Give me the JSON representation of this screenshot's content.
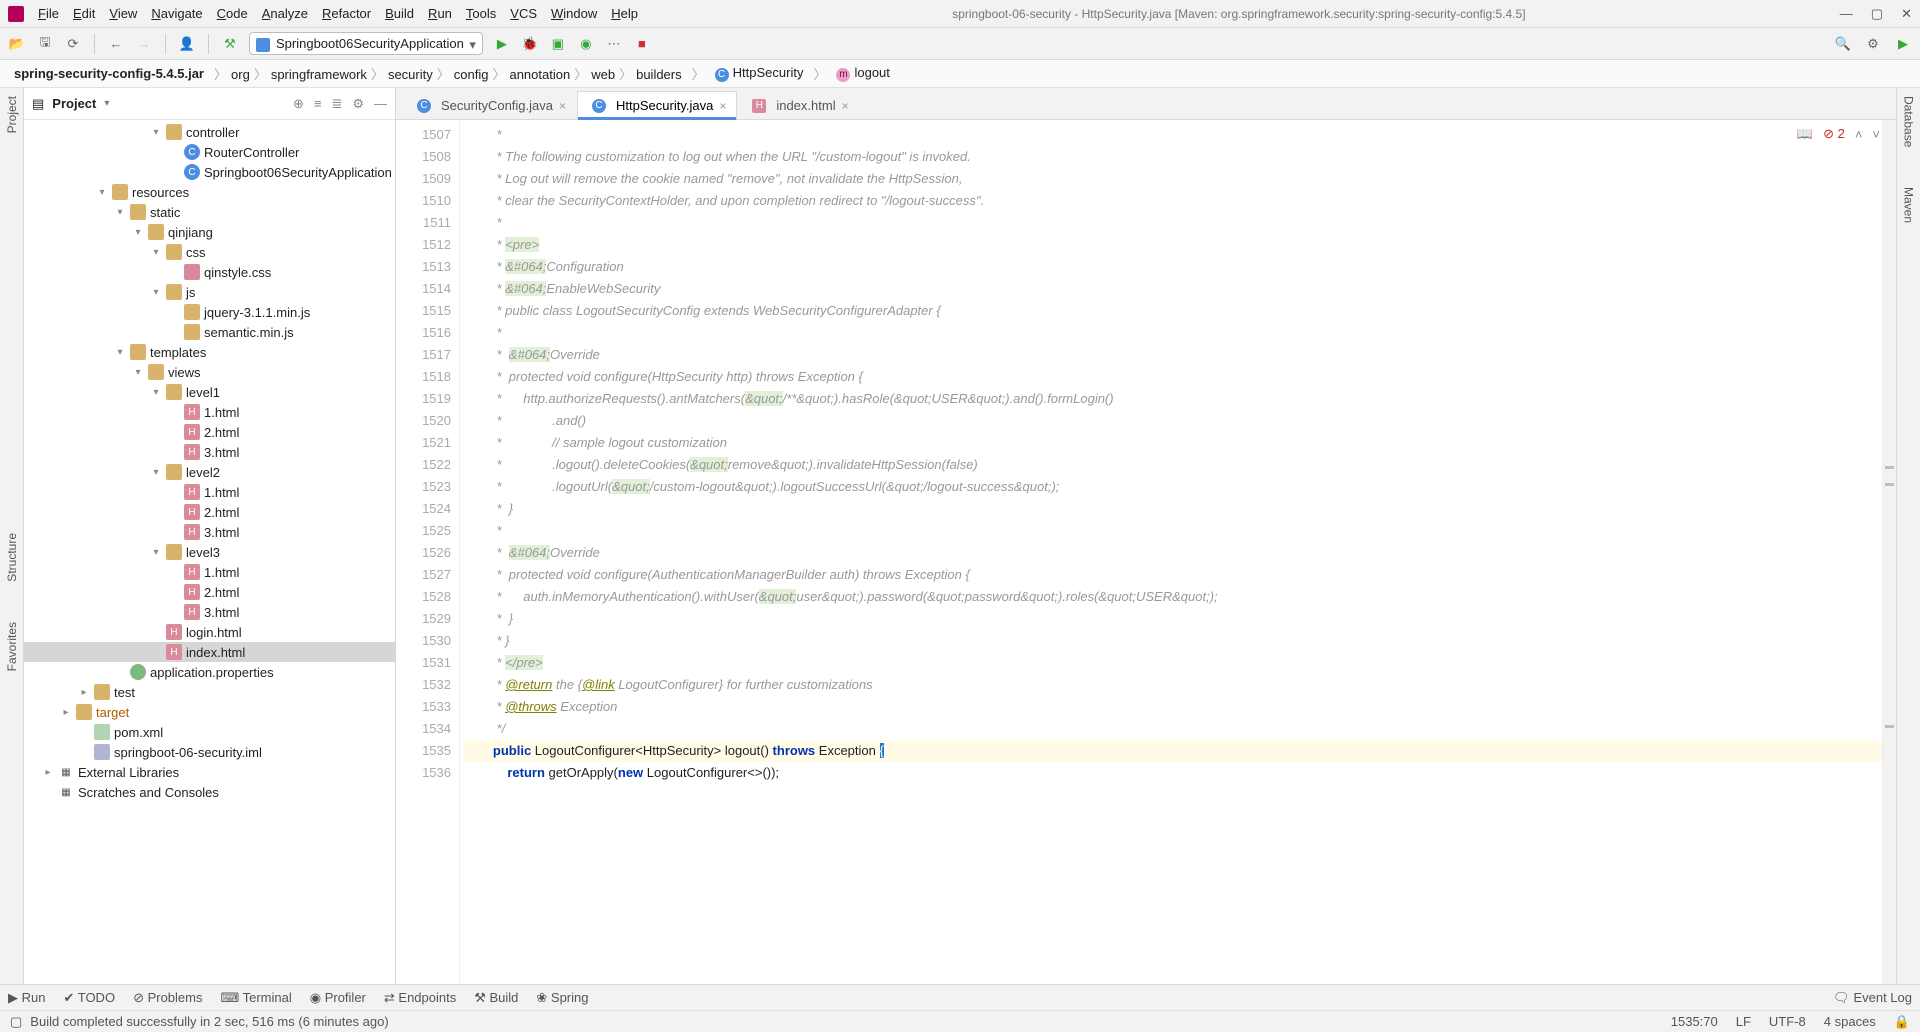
{
  "window": {
    "title": "springboot-06-security - HttpSecurity.java [Maven: org.springframework.security:spring-security-config:5.4.5]"
  },
  "menus": [
    "File",
    "Edit",
    "View",
    "Navigate",
    "Code",
    "Analyze",
    "Refactor",
    "Build",
    "Run",
    "Tools",
    "VCS",
    "Window",
    "Help"
  ],
  "run_config": "Springboot06SecurityApplication",
  "breadcrumbs": {
    "root": "spring-security-config-5.4.5.jar",
    "parts": [
      "org",
      "springframework",
      "security",
      "config",
      "annotation",
      "web",
      "builders"
    ],
    "class": "HttpSecurity",
    "method": "logout"
  },
  "sidebar": {
    "title": "Project",
    "tree": [
      {
        "indent": 7,
        "twist": "▾",
        "icon": "fold",
        "label": "controller"
      },
      {
        "indent": 8,
        "twist": "",
        "icon": "class",
        "label": "RouterController"
      },
      {
        "indent": 8,
        "twist": "",
        "icon": "class",
        "label": "Springboot06SecurityApplication"
      },
      {
        "indent": 4,
        "twist": "▾",
        "icon": "fold",
        "label": "resources"
      },
      {
        "indent": 5,
        "twist": "▾",
        "icon": "fold",
        "label": "static"
      },
      {
        "indent": 6,
        "twist": "▾",
        "icon": "fold",
        "label": "qinjiang"
      },
      {
        "indent": 7,
        "twist": "▾",
        "icon": "fold",
        "label": "css"
      },
      {
        "indent": 8,
        "twist": "",
        "icon": "css",
        "label": "qinstyle.css"
      },
      {
        "indent": 7,
        "twist": "▾",
        "icon": "fold",
        "label": "js"
      },
      {
        "indent": 8,
        "twist": "",
        "icon": "js",
        "label": "jquery-3.1.1.min.js"
      },
      {
        "indent": 8,
        "twist": "",
        "icon": "js",
        "label": "semantic.min.js"
      },
      {
        "indent": 5,
        "twist": "▾",
        "icon": "fold",
        "label": "templates"
      },
      {
        "indent": 6,
        "twist": "▾",
        "icon": "fold",
        "label": "views"
      },
      {
        "indent": 7,
        "twist": "▾",
        "icon": "fold",
        "label": "level1"
      },
      {
        "indent": 8,
        "twist": "",
        "icon": "html",
        "label": "1.html"
      },
      {
        "indent": 8,
        "twist": "",
        "icon": "html",
        "label": "2.html"
      },
      {
        "indent": 8,
        "twist": "",
        "icon": "html",
        "label": "3.html"
      },
      {
        "indent": 7,
        "twist": "▾",
        "icon": "fold",
        "label": "level2"
      },
      {
        "indent": 8,
        "twist": "",
        "icon": "html",
        "label": "1.html"
      },
      {
        "indent": 8,
        "twist": "",
        "icon": "html",
        "label": "2.html"
      },
      {
        "indent": 8,
        "twist": "",
        "icon": "html",
        "label": "3.html"
      },
      {
        "indent": 7,
        "twist": "▾",
        "icon": "fold",
        "label": "level3"
      },
      {
        "indent": 8,
        "twist": "",
        "icon": "html",
        "label": "1.html"
      },
      {
        "indent": 8,
        "twist": "",
        "icon": "html",
        "label": "2.html"
      },
      {
        "indent": 8,
        "twist": "",
        "icon": "html",
        "label": "3.html"
      },
      {
        "indent": 7,
        "twist": "",
        "icon": "html",
        "label": "login.html"
      },
      {
        "indent": 7,
        "twist": "",
        "icon": "html",
        "label": "index.html",
        "sel": true
      },
      {
        "indent": 5,
        "twist": "",
        "icon": "prop",
        "label": "application.properties"
      },
      {
        "indent": 3,
        "twist": "▸",
        "icon": "fold",
        "label": "test"
      },
      {
        "indent": 2,
        "twist": "▸",
        "icon": "fold",
        "label": "target",
        "color": "#b35900"
      },
      {
        "indent": 3,
        "twist": "",
        "icon": "xml",
        "label": "pom.xml"
      },
      {
        "indent": 3,
        "twist": "",
        "icon": "iml",
        "label": "springboot-06-security.iml"
      },
      {
        "indent": 1,
        "twist": "▸",
        "icon": "lib",
        "label": "External Libraries"
      },
      {
        "indent": 1,
        "twist": "",
        "icon": "lib",
        "label": "Scratches and Consoles"
      }
    ]
  },
  "tabs": [
    {
      "label": "SecurityConfig.java",
      "icon": "class",
      "active": false
    },
    {
      "label": "HttpSecurity.java",
      "icon": "class",
      "active": true
    },
    {
      "label": "index.html",
      "icon": "html",
      "active": false
    }
  ],
  "editor": {
    "first_line": 1507,
    "error_count": "2",
    "lines": [
      {
        "n": 1507,
        "t": "         *"
      },
      {
        "n": 1508,
        "t": "         * The following customization to log out when the URL \"/custom-logout\" is invoked."
      },
      {
        "n": 1509,
        "t": "         * Log out will remove the cookie named \"remove\", not invalidate the HttpSession,"
      },
      {
        "n": 1510,
        "t": "         * clear the SecurityContextHolder, and upon completion redirect to \"/logout-success\"."
      },
      {
        "n": 1511,
        "t": "         *"
      },
      {
        "n": 1512,
        "t": "         * <pre>",
        "hl": [
          "<pre>"
        ]
      },
      {
        "n": 1513,
        "t": "         * &#064;Configuration",
        "hl": [
          "&#064;"
        ]
      },
      {
        "n": 1514,
        "t": "         * &#064;EnableWebSecurity",
        "hl": [
          "&#064;"
        ]
      },
      {
        "n": 1515,
        "t": "         * public class LogoutSecurityConfig extends WebSecurityConfigurerAdapter {"
      },
      {
        "n": 1516,
        "t": "         *"
      },
      {
        "n": 1517,
        "t": "         *  &#064;Override",
        "hl": [
          "&#064;"
        ]
      },
      {
        "n": 1518,
        "t": "         *  protected void configure(HttpSecurity http) throws Exception {"
      },
      {
        "n": 1519,
        "t": "         *      http.authorizeRequests().antMatchers(&quot;/**&quot;).hasRole(&quot;USER&quot;).and().formLogin()",
        "hl": [
          "&quot;",
          "&quot;",
          "&quot;",
          "&quot;"
        ]
      },
      {
        "n": 1520,
        "t": "         *              .and()"
      },
      {
        "n": 1521,
        "t": "         *              // sample logout customization"
      },
      {
        "n": 1522,
        "t": "         *              .logout().deleteCookies(&quot;remove&quot;).invalidateHttpSession(false)",
        "hl": [
          "&quot;",
          "&quot;"
        ]
      },
      {
        "n": 1523,
        "t": "         *              .logoutUrl(&quot;/custom-logout&quot;).logoutSuccessUrl(&quot;/logout-success&quot;);",
        "hl": [
          "&quot;",
          "&quot;",
          "&quot;",
          "&quot;"
        ]
      },
      {
        "n": 1524,
        "t": "         *  }"
      },
      {
        "n": 1525,
        "t": "         *"
      },
      {
        "n": 1526,
        "t": "         *  &#064;Override",
        "hl": [
          "&#064;"
        ]
      },
      {
        "n": 1527,
        "t": "         *  protected void configure(AuthenticationManagerBuilder auth) throws Exception {"
      },
      {
        "n": 1528,
        "t": "         *      auth.inMemoryAuthentication().withUser(&quot;user&quot;).password(&quot;password&quot;).roles(&quot;USER&quot;);",
        "hl": [
          "&quot;",
          "&quot;",
          "&quot;",
          "&quot;",
          "&quot;",
          "&quot;"
        ]
      },
      {
        "n": 1529,
        "t": "         *  }"
      },
      {
        "n": 1530,
        "t": "         * }"
      },
      {
        "n": 1531,
        "t": "         * </pre>",
        "hl": [
          "</pre>"
        ]
      },
      {
        "n": 1532,
        "t": "         * @return the {@link LogoutConfigurer} for further customizations",
        "tag": [
          "@return",
          "@link"
        ]
      },
      {
        "n": 1533,
        "t": "         * @throws Exception",
        "tag": [
          "@throws"
        ]
      },
      {
        "n": 1534,
        "t": "         */"
      },
      {
        "n": 1535,
        "t": "        public LogoutConfigurer<HttpSecurity> logout() throws Exception {",
        "code": true,
        "cursor": true
      },
      {
        "n": 1536,
        "t": "            return getOrApply(new LogoutConfigurer<>());",
        "code": true
      }
    ]
  },
  "left_tools": [
    "Project",
    "Structure",
    "Favorites"
  ],
  "right_tools": [
    "Database",
    "Maven"
  ],
  "bottom_tools": [
    "Run",
    "TODO",
    "Problems",
    "Terminal",
    "Profiler",
    "Endpoints",
    "Build",
    "Spring"
  ],
  "bottom_right": "Event Log",
  "status": {
    "msg": "Build completed successfully in 2 sec, 516 ms (6 minutes ago)",
    "pos": "1535:70",
    "sep": "LF",
    "enc": "UTF-8",
    "indent": "4 spaces"
  }
}
